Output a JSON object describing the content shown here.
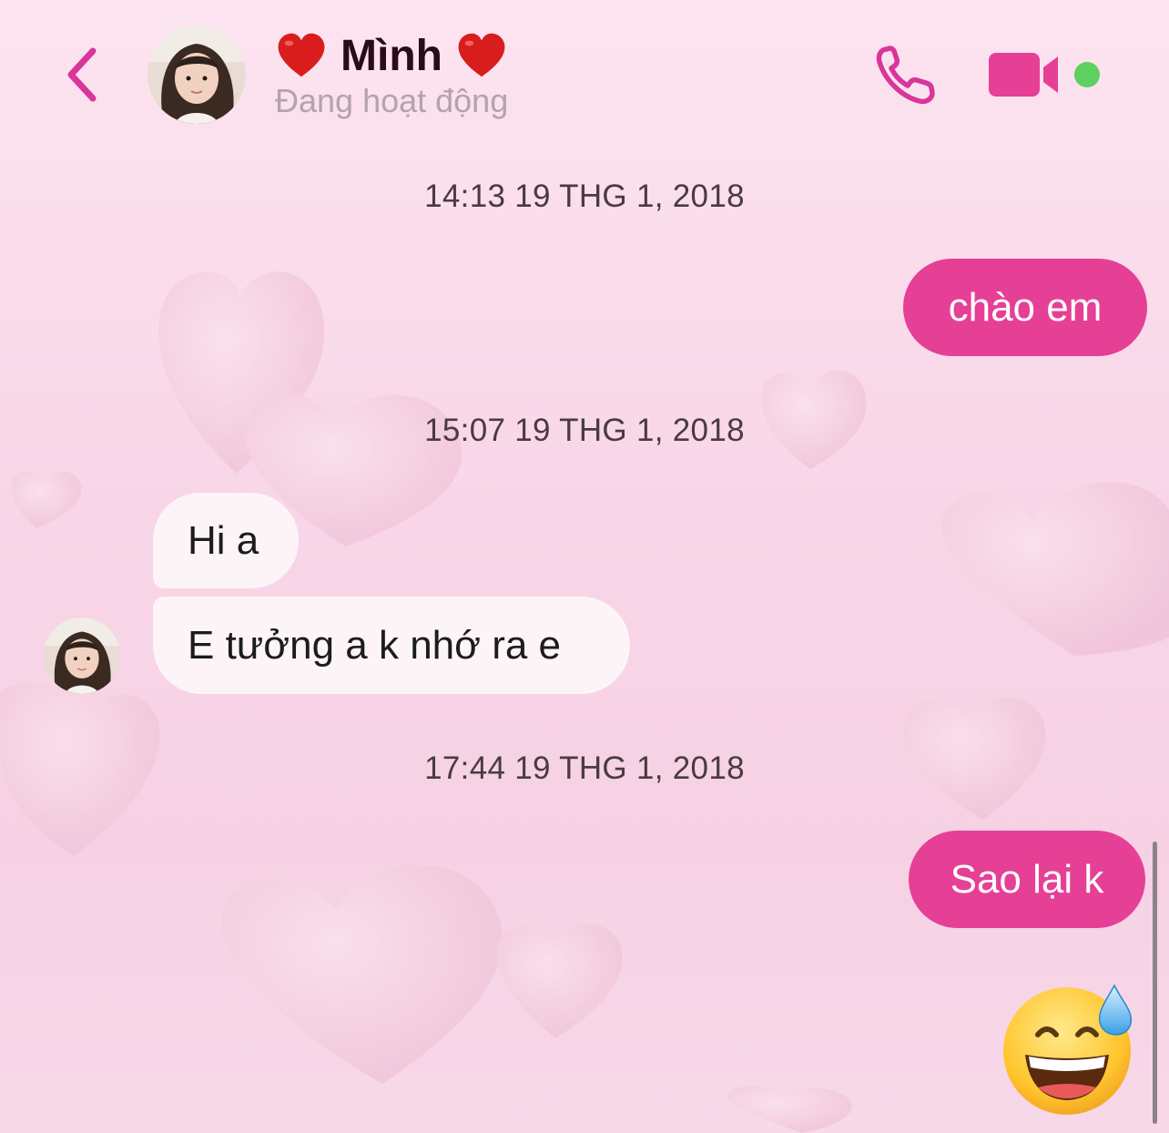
{
  "header": {
    "title": "Mình",
    "status": "Đang hoạt động",
    "back_icon": "chevron-left-icon",
    "call_icon": "phone-icon",
    "video_icon": "video-camera-icon",
    "title_decoration_icon": "red-heart-emoji",
    "accent_color": "#e63f96",
    "online_color": "#5dd05d"
  },
  "messages": {
    "timestamp_1": "14:13 19 THG 1, 2018",
    "out_1": "chào em",
    "timestamp_2": "15:07 19 THG 1, 2018",
    "in_1": "Hi a",
    "in_2": "E tưởng a k nhớ ra e",
    "timestamp_3": "17:44 19 THG 1, 2018",
    "out_2": "Sao lại k",
    "emoji": "grinning-face-with-sweat-emoji"
  },
  "theme": {
    "background": "pink-hearts",
    "outgoing_bubble_color": "#e63f96",
    "incoming_bubble_color": "#fdf4f7"
  }
}
